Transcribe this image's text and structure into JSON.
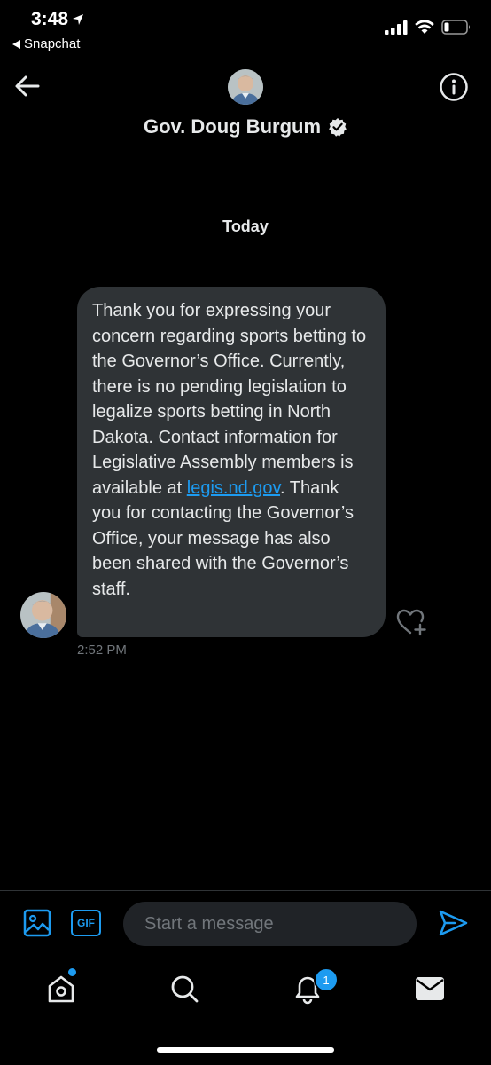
{
  "status_bar": {
    "time": "3:48",
    "back_app": "Snapchat"
  },
  "header": {
    "title": "Gov. Doug Burgum",
    "verified": true
  },
  "conversation": {
    "day_label": "Today",
    "message": {
      "text_before_link": "Thank you for expressing your concern regarding sports betting to the Governor’s Office. Currently, there is no pending legislation to legalize sports betting in North Dakota. Contact information for Legislative Assembly members is available at ",
      "link_text": "legis.nd.gov",
      "text_after_link": ". Thank you for contacting the Governor’s Office, your message has also been shared with the Governor’s staff.",
      "time": "2:52 PM"
    }
  },
  "composer": {
    "placeholder": "Start a message",
    "gif_label": "GIF"
  },
  "tab_bar": {
    "notifications_badge": "1"
  },
  "colors": {
    "accent": "#1d9bf0",
    "bubble": "#2f3336",
    "background": "#000000"
  }
}
